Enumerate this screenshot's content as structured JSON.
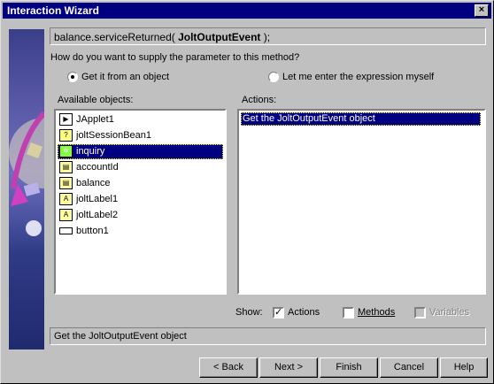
{
  "window": {
    "title": "Interaction Wizard",
    "close_glyph": "×"
  },
  "signature": {
    "prefix": "balance.serviceReturned(",
    "param": " JoltOutputEvent",
    "suffix": " );"
  },
  "prompt": "How do you want to supply the parameter to this method?",
  "radio_object": "Get it from an object",
  "radio_expression": "Let me enter the expression myself",
  "available_label": "Available objects:",
  "actions_label": "Actions:",
  "objects": [
    {
      "name": "JApplet1",
      "icon": "applet-icon"
    },
    {
      "name": "joltSessionBean1",
      "icon": "bean-icon"
    },
    {
      "name": "inquiry",
      "icon": "bean-icon",
      "selected": true
    },
    {
      "name": "accountId",
      "icon": "field-icon"
    },
    {
      "name": "balance",
      "icon": "field-icon"
    },
    {
      "name": "joltLabel1",
      "icon": "label-icon"
    },
    {
      "name": "joltLabel2",
      "icon": "label-icon"
    },
    {
      "name": "button1",
      "icon": "button-icon"
    }
  ],
  "actions": [
    "Get the JoltOutputEvent object"
  ],
  "show_label": "Show:",
  "show_actions": "Actions",
  "show_methods": "Methods",
  "show_variables": "Variables",
  "description": "Get the JoltOutputEvent object",
  "buttons": {
    "back": "< Back",
    "next": "Next >",
    "finish": "Finish",
    "cancel": "Cancel",
    "help": "Help"
  },
  "colors": {
    "titlebar": "#000080",
    "selection": "#000080",
    "face": "#c0c0c0"
  }
}
